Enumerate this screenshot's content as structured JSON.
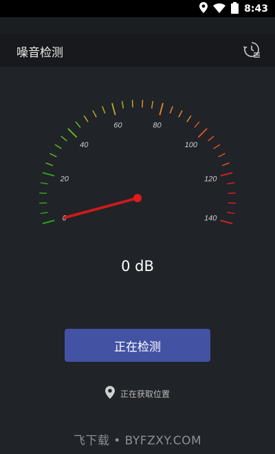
{
  "status_bar": {
    "time": "8:43",
    "icons": [
      "location-icon",
      "wifi-icon",
      "battery-icon"
    ]
  },
  "app_bar": {
    "title": "噪音检测",
    "history_icon": "history-icon"
  },
  "gauge": {
    "min": 0,
    "max": 140,
    "labels": [
      "0",
      "20",
      "40",
      "60",
      "80",
      "100",
      "120",
      "140"
    ],
    "needle_value": 0,
    "needle_color": "#cc1a1a",
    "zone_colors": [
      "#2f9e1f",
      "#5fb52a",
      "#b3a52a",
      "#d48a2a",
      "#d4512a",
      "#c82424"
    ]
  },
  "readout": {
    "value": "0 dB"
  },
  "start_button": {
    "label": "正在检测"
  },
  "location": {
    "icon": "location-pin-icon",
    "text": "正在获取位置"
  },
  "watermark": {
    "text": "飞下载 • BYFZXY.COM"
  },
  "colors": {
    "background": "#202327",
    "app_bar": "#17191c",
    "button": "#4352a3"
  }
}
